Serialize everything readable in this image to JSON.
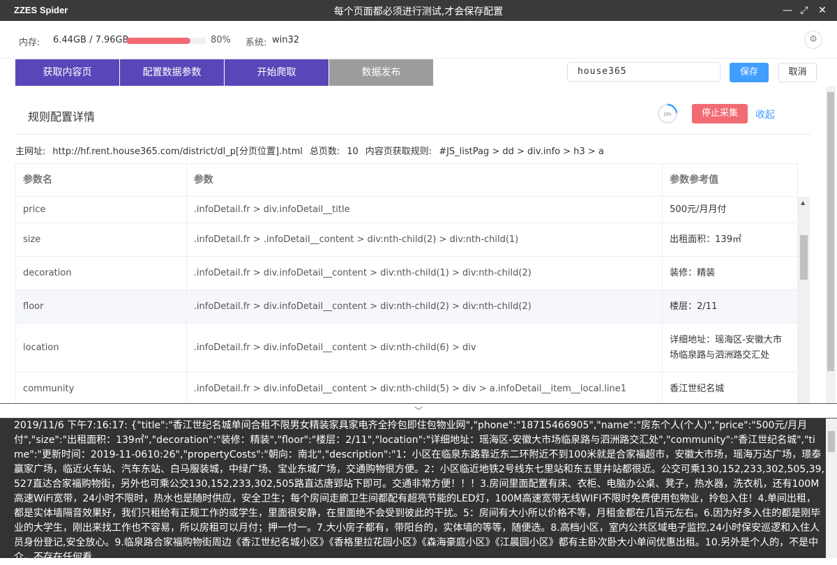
{
  "window": {
    "app_name": "ZZES Spider",
    "title": "每个页面都必须进行测试,才会保存配置",
    "minimize_icon": "—",
    "maximize_icon": "⤢",
    "close_icon": "✕"
  },
  "memory": {
    "label": "内存:",
    "value": "6.44GB / 7.96GB",
    "percent": 80,
    "percent_label": "80%",
    "system_label": "系统:",
    "system_value": "win32",
    "bar_color": "#f26b73"
  },
  "tabs": [
    {
      "label": "获取内容页"
    },
    {
      "label": "配置数据参数"
    },
    {
      "label": "开始爬取"
    },
    {
      "label": "数据发布"
    }
  ],
  "config": {
    "name_value": "house365",
    "save_label": "保存",
    "cancel_label": "取消"
  },
  "section": {
    "title": "规则配置详情",
    "progress_label": "23%",
    "stop_label": "停止采集",
    "collapse_label": "收起"
  },
  "info": {
    "url_label": "主网址:",
    "url_value": "http://hf.rent.house365.com/district/dl_p[分页位置].html",
    "pages_label": "总页数:",
    "pages_value": "10",
    "rule_label": "内容页获取规则:",
    "rule_value": "#JS_listPag > dd > div.info > h3 > a"
  },
  "table": {
    "headers": [
      "参数名",
      "参数",
      "参数参考值"
    ],
    "rows": [
      {
        "name": "price",
        "selector": ".infoDetail.fr > div.infoDetail__title",
        "value": "500元/月月付"
      },
      {
        "name": "size",
        "selector": ".infoDetail.fr > .infoDetail__content > div:nth-child(2) > div:nth-child(1)",
        "value": "出租面积：139㎡"
      },
      {
        "name": "decoration",
        "selector": ".infoDetail.fr > div.infoDetail__content > div:nth-child(1) > div:nth-child(2)",
        "value": "装修：精装"
      },
      {
        "name": "floor",
        "selector": ".infoDetail.fr > div.infoDetail__content > div:nth-child(2) > div:nth-child(2)",
        "value": "楼层：2/11"
      },
      {
        "name": "location",
        "selector": ".infoDetail.fr > div.infoDetail__content > div:nth-child(6) > div",
        "value": "详细地址：瑶海区-安徽大市场临泉路与泗洲路交汇处"
      },
      {
        "name": "community",
        "selector": ".infoDetail.fr > div.infoDetail__content > div:nth-child(5) > div > a.infoDetail__item__local.line1",
        "value": "香江世纪名城"
      }
    ]
  },
  "splitter_icon": "﹀",
  "log": {
    "text": "2019/11/6 下午7:16:17: {\"title\":\"香江世纪名城单间合租不限男女精装家具家电齐全拎包即住包物业网\",\"phone\":\"18715466905\",\"name\":\"房东个人(个人)\",\"price\":\"500元/月月付\",\"size\":\"出租面积：139㎡\",\"decoration\":\"装修：精装\",\"floor\":\"楼层：2/11\",\"location\":\"详细地址：瑶海区-安徽大市场临泉路与泗洲路交汇处\",\"community\":\"香江世纪名城\",\"time\":\"更新时间：2019-11-0610:26\",\"propertyCosts\":\"朝向：南北\",\"description\":\"1：小区在临泉东路靠近东二环附近不到100米就是合家福超市，安徽大市场，瑶海万达广场，璟泰赢家广场，临近火车站、汽车东站、白马服装城，中绿广场、宝业东城广场，交通购物很方便。2：小区临近地铁2号线东七里站和东五里井站都很近。公交可乘130,152,233,302,505,39,527直达合家福购物街，另外也可乘公交130,152,233,302,505路直达唐郢站下即可。交通非常方便！！！3.房间里面配置有床、衣柜、电脑办公桌、凳子，热水器，洗衣机，还有100M高速WiFi宽带，24小时不限时，热水也是随时供应，安全卫生；每个房间走廊卫生间都配有超亮节能的LED灯，100M高速宽带无线WIFI不限时免费使用包物业，拎包入住！4.单间出租，都是实体墙隔音效果好，我们只租给有正规工作的或学生，里面很安静，在里面绝不会受到彼此的干扰。5：房间有大小所以价格不等，月租金都在几百元左右。6.因为好多入住的都是刚毕业的大学生，刚出来找工作也不容易，所以房租可以月付；押一付一。7.大小房子都有，带阳台的，实体墙的等等，随便选。8.高档小区，室内公共区域电子监控,24小时保安巡逻和入住人员身份登记,安全放心。9.临泉路合家福购物街周边《香江世纪名城小区》《香格里拉花园小区》《森海豪庭小区》《江晨园小区》都有主卧次卧大小单间优惠出租。10.另外是个人的，不是中介。不存在任何看"
  }
}
